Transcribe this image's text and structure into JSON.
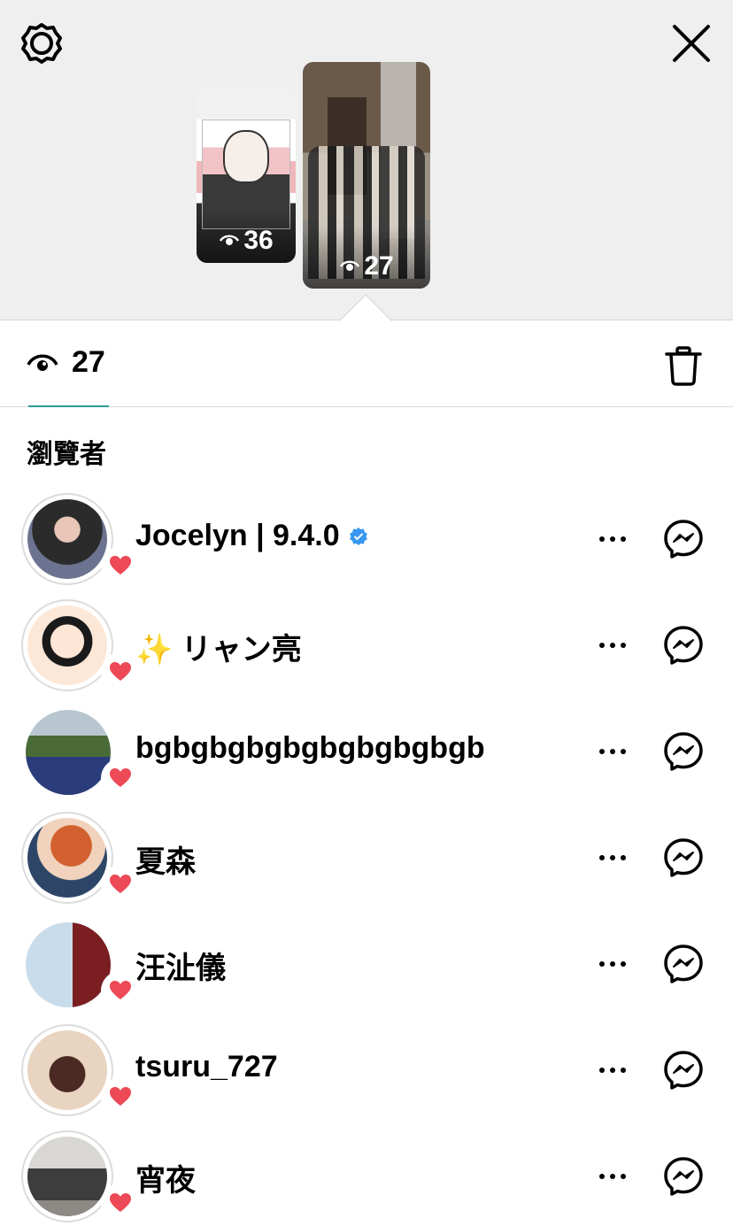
{
  "story_thumbs": [
    {
      "views": "36"
    },
    {
      "views": "27"
    }
  ],
  "summary": {
    "view_count": "27"
  },
  "viewers_title": "瀏覽者",
  "viewers": [
    {
      "name": "Jocelyn | 9.4.0",
      "verified": true,
      "liked": true
    },
    {
      "name": "✨ リャン亮",
      "verified": false,
      "liked": true
    },
    {
      "name": "bgbgbgbgbgbgbgbgbgb",
      "verified": false,
      "liked": true
    },
    {
      "name": "夏森",
      "verified": false,
      "liked": true
    },
    {
      "name": "汪沚儀",
      "verified": false,
      "liked": true
    },
    {
      "name": "tsuru_727",
      "verified": false,
      "liked": true
    },
    {
      "name": "宵夜",
      "verified": false,
      "liked": true
    }
  ],
  "colors": {
    "heart": "#ed4956",
    "verified": "#3897f0",
    "tab_underline": "#2a9d8f"
  },
  "icons": [
    "gear-icon",
    "close-icon",
    "eye-icon",
    "trash-icon",
    "heart-icon",
    "more-icon",
    "messenger-icon",
    "verified-icon"
  ]
}
